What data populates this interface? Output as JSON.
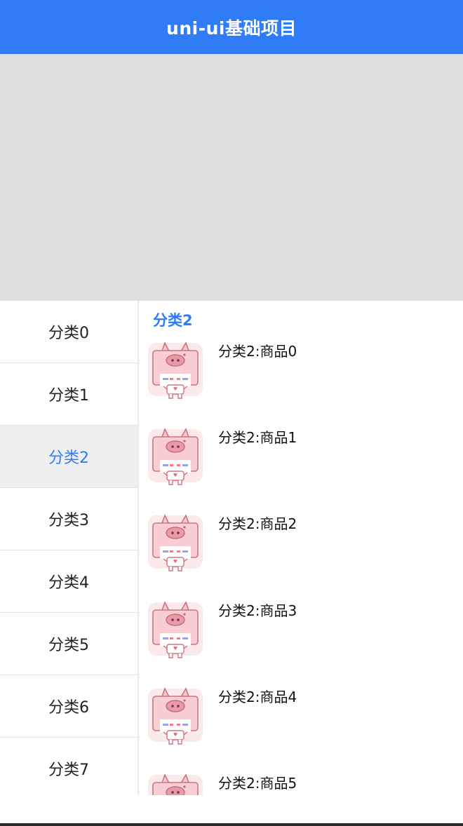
{
  "app": {
    "title": "uni-ui基础项目",
    "accent_color": "#2f7cf6"
  },
  "banner": {
    "color": "#e0e0e0"
  },
  "sidebar": {
    "items": [
      {
        "label": "分类0",
        "active": false
      },
      {
        "label": "分类1",
        "active": false
      },
      {
        "label": "分类2",
        "active": true
      },
      {
        "label": "分类3",
        "active": false
      },
      {
        "label": "分类4",
        "active": false
      },
      {
        "label": "分类5",
        "active": false
      },
      {
        "label": "分类6",
        "active": false
      },
      {
        "label": "分类7",
        "active": false
      }
    ]
  },
  "content": {
    "section_title": "分类2",
    "products": [
      {
        "name": "分类2:商品0",
        "icon": "pig-icon"
      },
      {
        "name": "分类2:商品1",
        "icon": "pig-icon"
      },
      {
        "name": "分类2:商品2",
        "icon": "pig-icon"
      },
      {
        "name": "分类2:商品3",
        "icon": "pig-icon"
      },
      {
        "name": "分类2:商品4",
        "icon": "pig-icon"
      },
      {
        "name": "分类2:商品5",
        "icon": "pig-icon"
      }
    ]
  }
}
